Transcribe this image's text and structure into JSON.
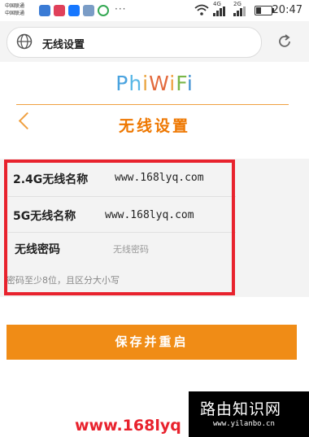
{
  "status_bar": {
    "carrier_1": "中国联通",
    "carrier_2": "中国联通",
    "app_icons": [
      "blue-app-icon",
      "pink-app-icon",
      "alipay-icon",
      "gallery-icon",
      "chrome-icon"
    ],
    "app_colors": [
      "#3a7bd5",
      "#e0405a",
      "#1677ff",
      "#7a9cc6",
      "#34a853"
    ],
    "more": "···",
    "network_4g": "4G",
    "network_2g": "2G",
    "time": "20:47"
  },
  "address_bar": {
    "url_text": "无线设置",
    "globe_icon": "globe-icon",
    "reload_icon": "reload-icon"
  },
  "page": {
    "logo": "PhiWiFi",
    "logo_colors": [
      "#4aa3df",
      "#58b7e6",
      "#e9a23b",
      "#e36a3d",
      "#f0a040",
      "#7ab648",
      "#3f8fd2"
    ],
    "title": "无线设置",
    "fields": [
      {
        "label": "2.4G无线名称",
        "value": "www.168lyq.com"
      },
      {
        "label": "5G无线名称",
        "value": "www.168lyq.com"
      },
      {
        "label": "无线密码",
        "placeholder": "无线密码"
      }
    ],
    "hint": "密码至少8位，且区分大小写",
    "save_button": "保存并重启"
  },
  "watermark": {
    "red_text": "www.168lyq",
    "site_title": "路由知识网",
    "site_url": "www.yilanbo.cn"
  },
  "colors": {
    "accent": "#f08c16",
    "title": "#ee7700",
    "highlight": "#e8222d"
  }
}
